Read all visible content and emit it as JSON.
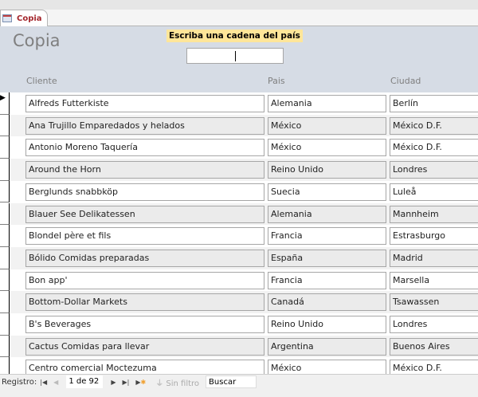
{
  "tab": {
    "label": "Copia"
  },
  "form": {
    "title": "Copia",
    "search_prompt": "Escriba una cadena del país",
    "search_value": ""
  },
  "columns": [
    "Cliente",
    "Pais",
    "Ciudad"
  ],
  "rows": [
    [
      "Alfreds Futterkiste",
      "Alemania",
      "Berlín"
    ],
    [
      "Ana Trujillo Emparedados y helados",
      "México",
      "México D.F."
    ],
    [
      "Antonio Moreno Taquería",
      "México",
      "México D.F."
    ],
    [
      "Around the Horn",
      "Reino Unido",
      "Londres"
    ],
    [
      "Berglunds snabbköp",
      "Suecia",
      "Luleå"
    ],
    [
      "Blauer See Delikatessen",
      "Alemania",
      "Mannheim"
    ],
    [
      "Blondel père et fils",
      "Francia",
      "Estrasburgo"
    ],
    [
      "Bólido Comidas preparadas",
      "España",
      "Madrid"
    ],
    [
      "Bon app'",
      "Francia",
      "Marsella"
    ],
    [
      "Bottom-Dollar Markets",
      "Canadá",
      "Tsawassen"
    ],
    [
      "B's Beverages",
      "Reino Unido",
      "Londres"
    ],
    [
      "Cactus Comidas para llevar",
      "Argentina",
      "Buenos Aires"
    ],
    [
      "Centro comercial Moctezuma",
      "México",
      "México D.F."
    ]
  ],
  "nav": {
    "label": "Registro:",
    "record": "1 de 92",
    "filter": "Sin filtro",
    "search": "Buscar"
  }
}
